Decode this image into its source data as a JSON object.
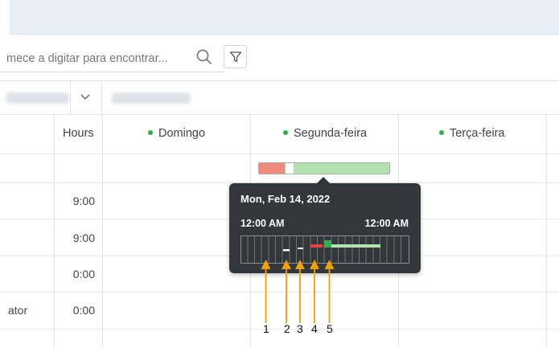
{
  "search": {
    "placeholder": "mece a digitar para encontrar..."
  },
  "columns": {
    "hours": "Hours",
    "days": [
      "Domingo",
      "Segunda-feira",
      "Terça-feira"
    ]
  },
  "rows": [
    {
      "label": "",
      "hours": ""
    },
    {
      "label": "",
      "hours": "9:00"
    },
    {
      "label": "",
      "hours": "9:00"
    },
    {
      "label": "",
      "hours": "0:00"
    },
    {
      "label": "ator",
      "hours": "0:00"
    }
  ],
  "usage_bar": {
    "red_fraction": 0.2,
    "white_fraction": 0.07,
    "green_fraction": 0.73
  },
  "tooltip": {
    "date": "Mon, Feb 14, 2022",
    "start_time": "12:00 AM",
    "end_time": "12:00 AM"
  },
  "callouts": [
    "1",
    "2",
    "3",
    "4",
    "5"
  ],
  "colors": {
    "accent_green": "#2bb24c",
    "usage_red": "#f08a7a",
    "usage_green": "#b2e2b2",
    "tooltip_bg": "#33363b",
    "arrow_orange": "#f2a100",
    "active_red": "#e0443a",
    "active_green": "#2bb24c"
  }
}
